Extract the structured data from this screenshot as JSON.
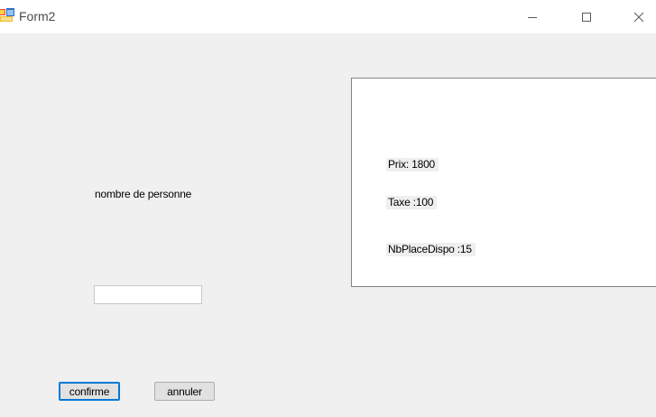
{
  "window": {
    "title": "Form2",
    "controls": {
      "minimize": "minimize-icon",
      "maximize": "maximize-icon",
      "close": "close-icon"
    }
  },
  "form": {
    "nombre_label": "nombre de personne",
    "nombre_value": "",
    "confirm_label": "confirme",
    "cancel_label": "annuler"
  },
  "info_panel": {
    "prix": "Prix: 1800",
    "taxe": "Taxe :100",
    "nb_places": "NbPlaceDispo :15"
  },
  "colors": {
    "client_background": "#f0f0f0",
    "titlebar_background": "#ffffff",
    "focus_border": "#0078d7"
  }
}
